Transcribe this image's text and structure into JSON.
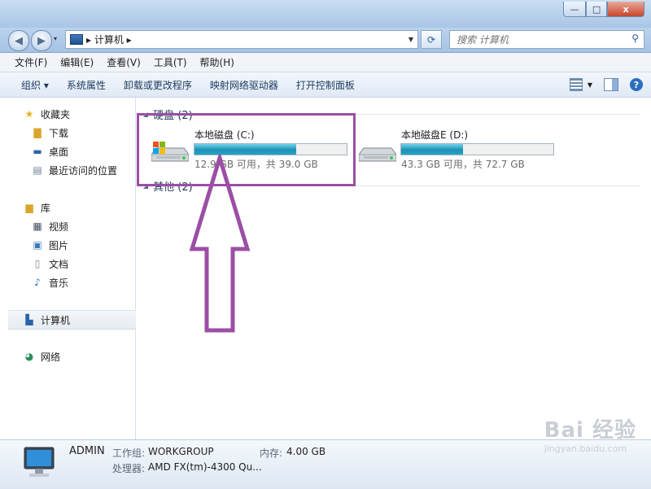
{
  "window": {
    "minimize_glyph": "—",
    "maximize_glyph": "□",
    "close_glyph": "x"
  },
  "nav": {
    "back_glyph": "◀",
    "forward_glyph": "▶",
    "address_crumb": "▸ 计算机 ▸",
    "search_placeholder": "搜索 计算机"
  },
  "menu": [
    "文件(F)",
    "编辑(E)",
    "查看(V)",
    "工具(T)",
    "帮助(H)"
  ],
  "toolbar": [
    "组织 ▾",
    "系统属性",
    "卸载或更改程序",
    "映射网络驱动器",
    "打开控制面板"
  ],
  "sidebar": {
    "favorites": {
      "label": "收藏夹",
      "items": [
        "下载",
        "桌面",
        "最近访问的位置"
      ]
    },
    "libraries": {
      "label": "库",
      "items": [
        "视频",
        "图片",
        "文档",
        "音乐"
      ]
    },
    "computer": "计算机",
    "network": "网络"
  },
  "content": {
    "group_hdd": "硬盘 (2)",
    "group_other": "其他 (2)",
    "drives": [
      {
        "name": "本地磁盘 (C:)",
        "info": "12.9 GB 可用，共 39.0 GB",
        "used_fraction": 0.669
      },
      {
        "name": "本地磁盘E (D:)",
        "info": "43.3 GB 可用，共 72.7 GB",
        "used_fraction": 0.404
      }
    ]
  },
  "details": {
    "computer_name": "ADMIN",
    "workgroup_label": "工作组:",
    "workgroup_value": "WORKGROUP",
    "memory_label": "内存:",
    "memory_value": "4.00 GB",
    "cpu_label": "处理器:",
    "cpu_value": "AMD FX(tm)-4300 Qu..."
  },
  "watermark": {
    "brand": "Bai 经验",
    "url": "jingyan.baidu.com"
  },
  "colors": {
    "highlight": "#9b4fa4",
    "bar_fill": "#1e90b5"
  }
}
